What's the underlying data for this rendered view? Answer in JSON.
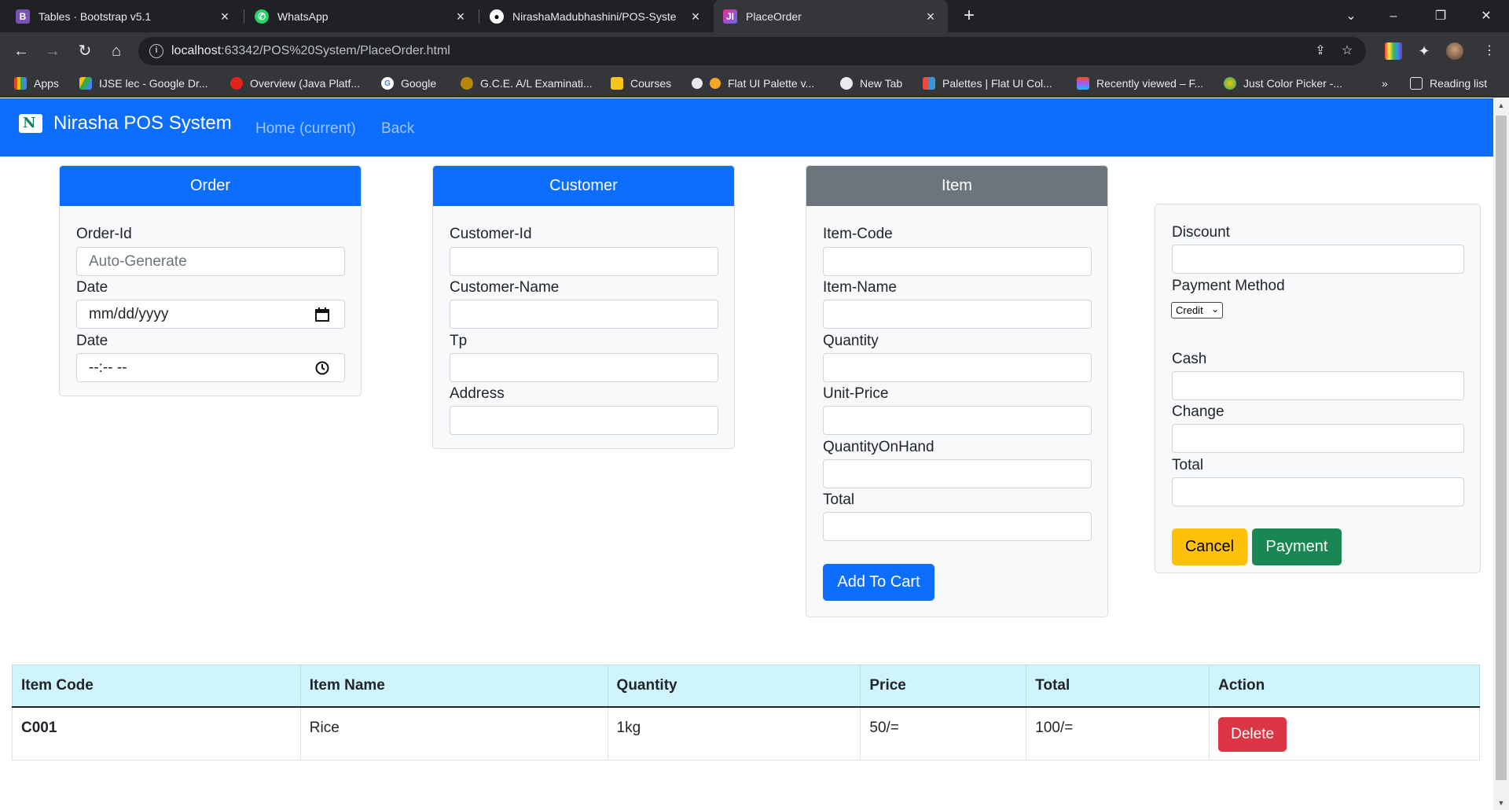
{
  "browser": {
    "tabs": [
      {
        "title": "Tables · Bootstrap v5.1",
        "icon": "bootstrap-icon",
        "color": "#7952b3"
      },
      {
        "title": "WhatsApp",
        "icon": "whatsapp-icon",
        "color": "#25d366"
      },
      {
        "title": "NirashaMadubhashini/POS-Syste",
        "icon": "github-icon",
        "color": "#ffffff"
      },
      {
        "title": "PlaceOrder",
        "icon": "webstorm-icon",
        "color": "#5b6bf5"
      }
    ],
    "url_host": "localhost",
    "url_rest": ":63342/POS%20System/PlaceOrder.html",
    "bookmarks": [
      {
        "label": "Apps"
      },
      {
        "label": "IJSE lec - Google Dr..."
      },
      {
        "label": "Overview (Java Platf..."
      },
      {
        "label": "Google"
      },
      {
        "label": "G.C.E. A/L Examinati..."
      },
      {
        "label": "Courses"
      },
      {
        "label": "Flat UI Palette v..."
      },
      {
        "label": "New Tab"
      },
      {
        "label": "Palettes | Flat UI Col..."
      },
      {
        "label": "Recently viewed – F..."
      },
      {
        "label": "Just Color Picker -..."
      }
    ],
    "more_bookmarks": "»",
    "reading_list": "Reading list"
  },
  "navbar": {
    "brand": "Nirasha POS System",
    "home": "Home (current)",
    "back": "Back"
  },
  "order": {
    "header": "Order",
    "order_id_label": "Order-Id",
    "order_id_placeholder": "Auto-Generate",
    "date_label": "Date",
    "date_placeholder": "mm/dd/yyyy",
    "time_label": "Date",
    "time_placeholder": "--:-- --"
  },
  "customer": {
    "header": "Customer",
    "id_label": "Customer-Id",
    "name_label": "Customer-Name",
    "tp_label": "Tp",
    "address_label": "Address"
  },
  "item": {
    "header": "Item",
    "code_label": "Item-Code",
    "name_label": "Item-Name",
    "qty_label": "Quantity",
    "unit_price_label": "Unit-Price",
    "qoh_label": "QuantityOnHand",
    "total_label": "Total",
    "add_to_cart": "Add To Cart"
  },
  "payment": {
    "discount_label": "Discount",
    "method_label": "Payment Method",
    "method_value": "Credit",
    "cash_label": "Cash",
    "change_label": "Change",
    "total_label": "Total",
    "cancel": "Cancel",
    "pay": "Payment"
  },
  "cart": {
    "headers": [
      "Item Code",
      "Item Name",
      "Quantity",
      "Price",
      "Total",
      "Action"
    ],
    "rows": [
      {
        "code": "C001",
        "name": "Rice",
        "qty": "1kg",
        "price": "50/=",
        "total": "100/=",
        "action": "Delete"
      }
    ]
  },
  "colors": {
    "primary": "#0d6efd",
    "secondary": "#6c757d",
    "warning": "#ffc107",
    "success": "#198754",
    "danger": "#dc3545",
    "table_head": "#cff4fc"
  }
}
